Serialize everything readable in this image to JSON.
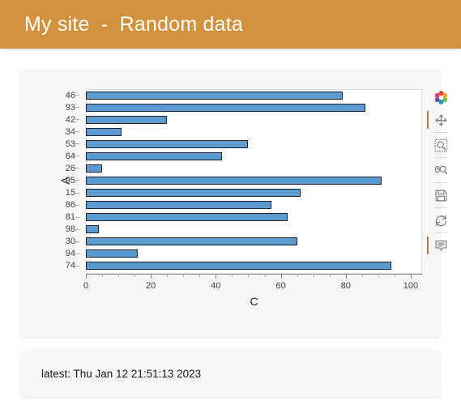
{
  "header": {
    "title": "My site  -  Random data",
    "bg_color": "#d4913c",
    "text_color": "#ffffff"
  },
  "plot": {
    "toolbar": {
      "tools": [
        {
          "name": "bokeh-logo-icon",
          "label": "Bokeh",
          "active": false
        },
        {
          "name": "pan-icon",
          "label": "Pan",
          "active": true
        },
        {
          "name": "box-zoom-icon",
          "label": "Box Zoom",
          "active": false
        },
        {
          "name": "wheel-zoom-icon",
          "label": "Wheel Zoom",
          "active": false
        },
        {
          "name": "save-icon",
          "label": "Save",
          "active": false
        },
        {
          "name": "reset-icon",
          "label": "Reset",
          "active": false
        },
        {
          "name": "hover-icon",
          "label": "Hover",
          "active": true
        }
      ]
    }
  },
  "chart_data": {
    "type": "bar",
    "orientation": "horizontal",
    "title": "",
    "xlabel": "C",
    "ylabel": "A",
    "categories": [
      "46",
      "93",
      "42",
      "34",
      "53",
      "64",
      "26",
      "95",
      "15",
      "86",
      "81",
      "98",
      "30",
      "94",
      "74"
    ],
    "values": [
      79,
      86,
      25,
      11,
      50,
      42,
      5,
      91,
      66,
      57,
      62,
      4,
      65,
      16,
      94
    ],
    "xlim": [
      0,
      103
    ],
    "xticks": [
      0,
      20,
      40,
      60,
      80,
      100
    ],
    "xticklabels": [
      "0",
      "20",
      "40",
      "60",
      "80",
      "100"
    ],
    "grid": false,
    "legend": null,
    "bar_color": "#5b9bd1",
    "bar_line_color": "#222222"
  },
  "footer": {
    "status": "latest: Thu Jan 12 21:51:13 2023"
  }
}
